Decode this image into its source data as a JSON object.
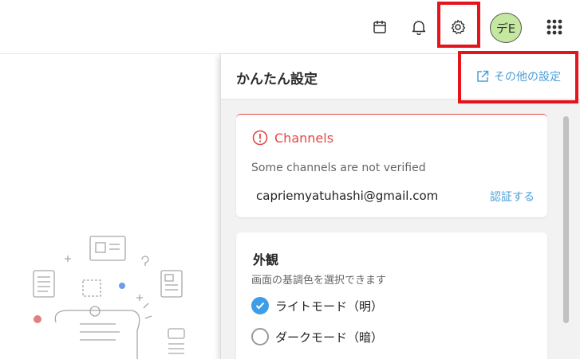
{
  "topbar": {
    "icons": [
      "calendar-icon",
      "bell-icon",
      "gear-icon",
      "apps-grid-icon"
    ],
    "avatar_text": "デE"
  },
  "panel": {
    "title": "かんたん設定",
    "more_settings_label": "その他の設定"
  },
  "channels": {
    "title": "Channels",
    "description": "Some channels are not verified",
    "email": "capriemyatuhashi@gmail.com",
    "verify_label": "認証する"
  },
  "appearance": {
    "title": "外観",
    "description": "画面の基調色を選択できます",
    "options": [
      {
        "label": "ライトモード（明）",
        "selected": true
      },
      {
        "label": "ダークモード（暗）",
        "selected": false
      }
    ]
  },
  "colors": {
    "highlight": "#e5141a",
    "accent": "#4a9fd8",
    "error": "#e24848",
    "avatar_bg": "#c4e8a0"
  }
}
